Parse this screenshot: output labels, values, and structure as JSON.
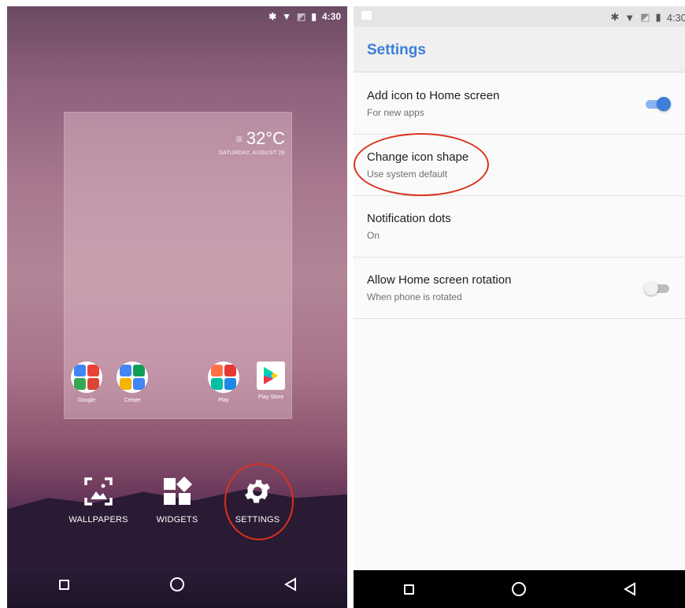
{
  "colors": {
    "accent": "#3b7fd9",
    "annotation_red": "#d9321e",
    "toggle_on_track": "#8ab4f0",
    "toggle_on_thumb": "#3b7fd9",
    "toggle_off_track": "#bdbdbd",
    "toggle_off_thumb": "#f1f1f1"
  },
  "left_phone": {
    "status_bar": {
      "icons": [
        "bluetooth-icon",
        "wifi-icon",
        "no-sim-icon",
        "battery-icon"
      ],
      "time": "4:30"
    },
    "weather": {
      "temperature": "32°C",
      "date": "SATURDAY, AUGUST 26",
      "icon": "haze-icon"
    },
    "apps": [
      {
        "label": "Google",
        "icon": "google-folder-icon"
      },
      {
        "label": "Create",
        "icon": "create-folder-icon"
      },
      {
        "label": "Play",
        "icon": "play-folder-icon"
      },
      {
        "label": "Play Store",
        "icon": "play-store-icon"
      }
    ],
    "dock": {
      "wallpapers": "WALLPAPERS",
      "widgets": "WIDGETS",
      "settings": "SETTINGS"
    },
    "nav": [
      "recents-icon",
      "home-icon",
      "back-icon"
    ]
  },
  "right_phone": {
    "status_bar": {
      "icons": [
        "image-icon",
        "bluetooth-icon",
        "wifi-icon",
        "no-sim-icon",
        "battery-icon"
      ],
      "time": "4:30"
    },
    "title": "Settings",
    "rows": [
      {
        "title": "Add icon to Home screen",
        "subtitle": "For new apps",
        "toggle": true,
        "toggle_on": true
      },
      {
        "title": "Change icon shape",
        "subtitle": "Use system default",
        "toggle": false,
        "annotated": true
      },
      {
        "title": "Notification dots",
        "subtitle": "On",
        "toggle": false
      },
      {
        "title": "Allow Home screen rotation",
        "subtitle": "When phone is rotated",
        "toggle": true,
        "toggle_on": false
      }
    ],
    "nav": [
      "recents-icon",
      "home-icon",
      "back-icon"
    ]
  }
}
